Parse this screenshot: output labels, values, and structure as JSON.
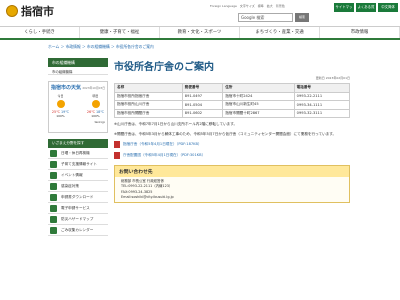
{
  "header": {
    "site_name": "指宿市",
    "utility": "Foreign Language　文字サイズ　標準　拡大　背景色",
    "search_placeholder": "Google 検索",
    "search_button": "検索",
    "buttons": [
      "サイトマップ",
      "よくある質問",
      "中文简体"
    ]
  },
  "gnav": [
    "くらし・手続き",
    "健康・子育て・福祉",
    "教育・文化・スポーツ",
    "まちづくり・産業・交通",
    "市政情報"
  ],
  "breadcrumb": "ホーム ＞ 市政情報 ＞ 市の組織機構 ＞ 市役所各庁舎のご案内",
  "sidebar": {
    "head": "市の組織機構",
    "sub": "市の組織機構",
    "weather": {
      "title": "指宿市の天気",
      "date": "2023年10月03日",
      "today": {
        "label": "今日",
        "hi": "25℃",
        "lo": "19℃",
        "pct": "100%"
      },
      "tomorrow": {
        "label": "明日",
        "hi": "26℃",
        "lo": "18℃",
        "pct": "100%"
      },
      "source": "tenki.jp"
    },
    "head2": "いざまえ分野を探す",
    "links": [
      "日曜・休日再検機",
      "子育て支援情報サイト",
      "イベント情報",
      "感染症対策",
      "申請書ダウンロード",
      "電子申請サービス",
      "防災ハザードマップ",
      "ごみ収集カレンダー"
    ]
  },
  "main": {
    "title": "市役所各庁舎のご案内",
    "updated": "更新日 2023年02月01日",
    "table": {
      "headers": [
        "名称",
        "郵便番号",
        "住所",
        "電話番号"
      ],
      "rows": [
        [
          "指宿市役所指宿庁舎",
          "891-0497",
          "指宿市十町2424",
          "0993-22-2111"
        ],
        [
          "指宿市役所山川庁舎",
          "891-0504",
          "指宿市山川新生町45",
          "0993-34-1111"
        ],
        [
          "指宿市役所開聞庁舎",
          "891-0602",
          "指宿市開聞十町2867",
          "0993-32-3111"
        ]
      ]
    },
    "para1": "※山川庁舎は、令和7年7月1日から山川支所ホール内2階に移転しています。",
    "para2": "※開聞庁舎は、令和5年3月から解体工事のため、令和5年5月7日から仮庁舎（コミュニティセンター開聞会館）にて業務を行っています。",
    "files": [
      "指宿庁舎（令和5年4月1日現在）（PDF:187KB）",
      "庁舎配置図（令和5年4月1日現在）（PDF:301KB）"
    ],
    "contact": {
      "head": "お問い合わせ先",
      "lines": [
        "総務部 市長公室 行政経営係",
        "TEL:0993-22-2111（内線123）",
        "FAX:0993-24-3825",
        "Email:soshiki@city.ibusuki.lg.jp"
      ]
    }
  }
}
